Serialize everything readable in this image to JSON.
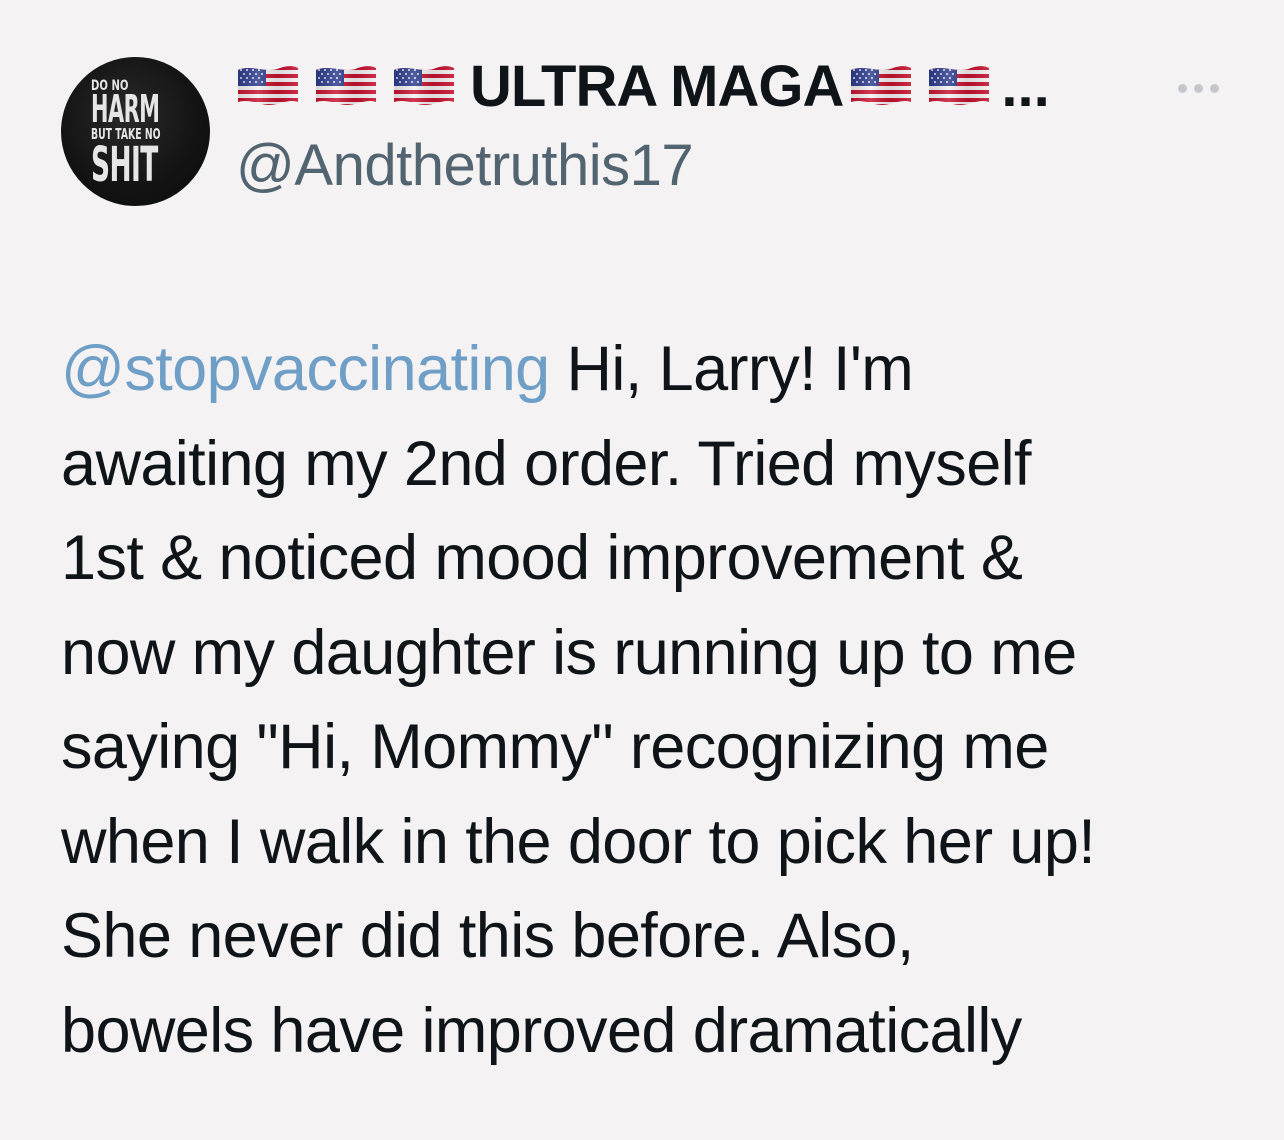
{
  "colors": {
    "background": "#f4f2f3",
    "text_primary": "#0f1419",
    "text_secondary": "#536471",
    "mention": "#6f9fc6",
    "more_dots": "#c4c8cc",
    "avatar_bg": "#141414"
  },
  "author": {
    "avatar": {
      "icon": "profile-avatar",
      "text_lines": [
        "DO NO",
        "HARM",
        "BUT TAKE NO",
        "SHIT"
      ]
    },
    "flags_before": 3,
    "flags_after": 2,
    "flag_icon": "us-flag-emoji",
    "display_name": "ULTRA MAGA",
    "truncation": "...",
    "handle": "@Andthetruthis17"
  },
  "more_menu": {
    "icon": "more-horizontal-icon"
  },
  "tweet": {
    "mention": "@stopvaccinating",
    "lines": [
      " Hi, Larry! I'm",
      "awaiting my 2nd order. Tried myself",
      "1st & noticed mood improvement &",
      "now my daughter is running up to me",
      "saying \"Hi, Mommy\" recognizing me",
      "when I walk in the door to pick her up!",
      "She never did this before. Also,",
      "bowels have improved dramatically"
    ]
  }
}
